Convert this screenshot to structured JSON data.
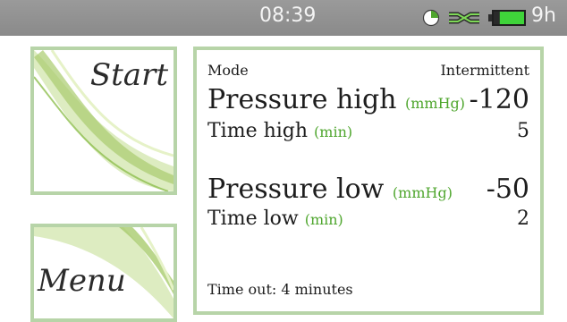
{
  "status_bar": {
    "time": "08:39",
    "battery_text": "9h",
    "icons": [
      "clock-icon",
      "connection-icon",
      "battery-icon"
    ],
    "battery_level": 0.8
  },
  "tiles": {
    "start_label": "Start",
    "menu_label": "Menu"
  },
  "settings": {
    "mode_label": "Mode",
    "mode_value": "Intermittent",
    "pressure_high_label": "Pressure high",
    "pressure_high_unit": "(mmHg)",
    "pressure_high_value": "-120",
    "time_high_label": "Time high",
    "time_high_unit": "(min)",
    "time_high_value": "5",
    "pressure_low_label": "Pressure low",
    "pressure_low_unit": "(mmHg)",
    "pressure_low_value": "-50",
    "time_low_label": "Time low",
    "time_low_unit": "(min)",
    "time_low_value": "2",
    "timeout_text": "Time out: 4 minutes"
  },
  "colors": {
    "accent_green": "#4fa62e",
    "border_green": "#b7d4a8",
    "status_bar_gray": "#8f8f8f"
  }
}
